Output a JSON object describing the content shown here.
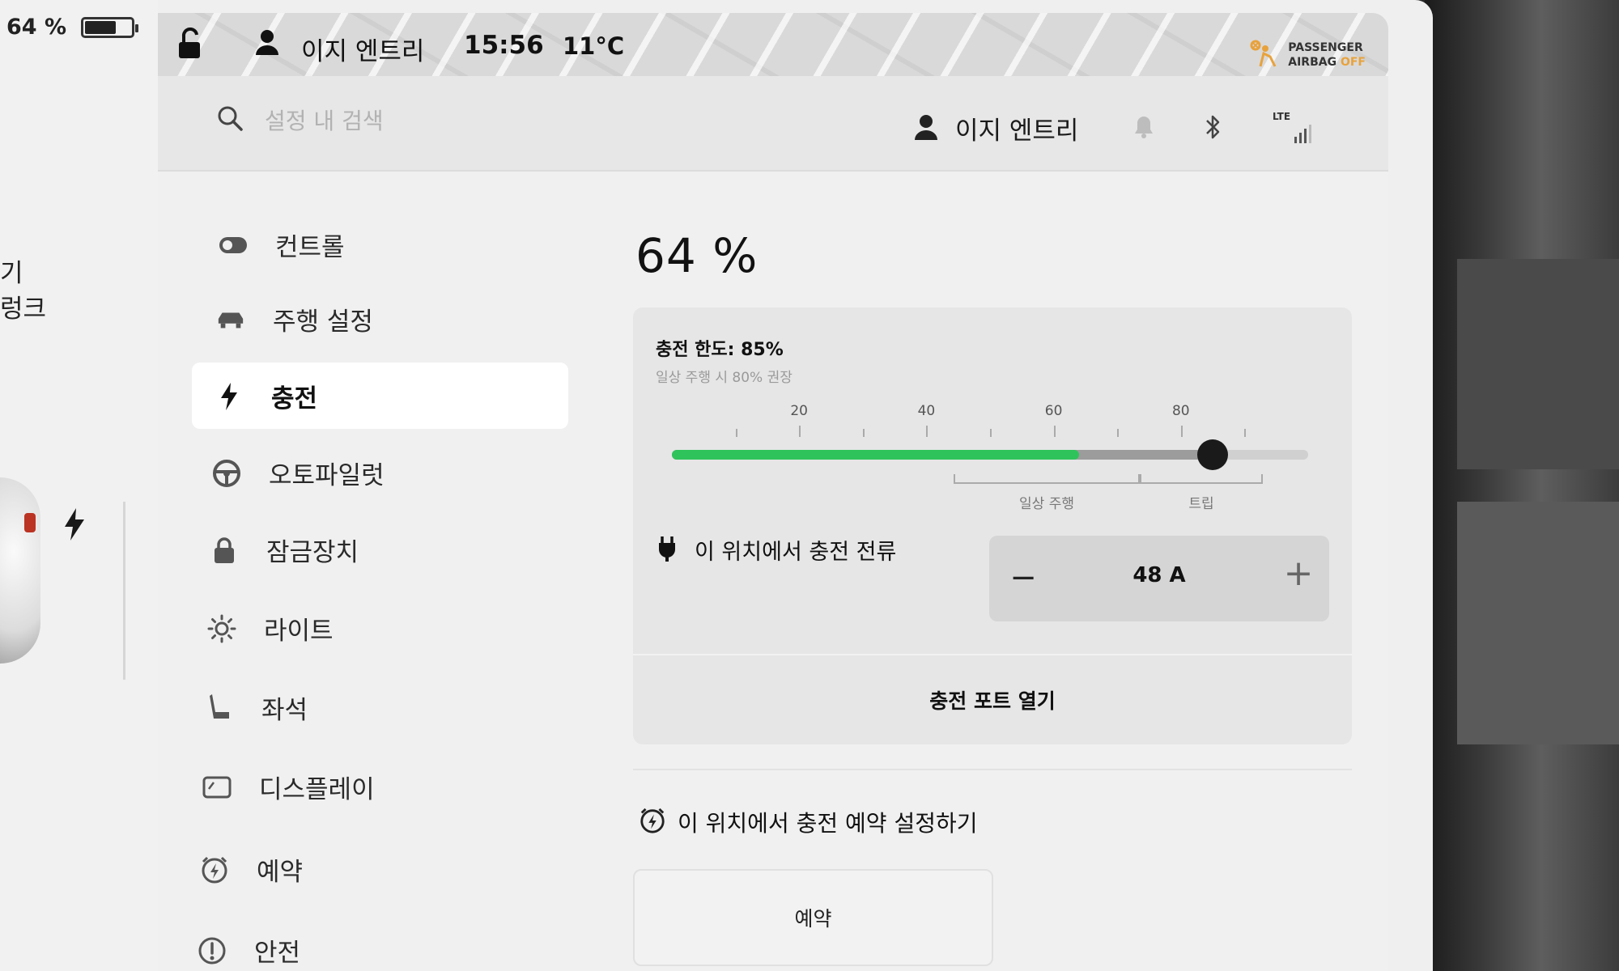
{
  "left_panel": {
    "battery_percent": "64 %",
    "battery_level": 0.64,
    "label_line1": "기",
    "label_line2": "렁크"
  },
  "status_bar": {
    "driver_name": "이지 엔트리",
    "time": "15:56",
    "temperature": "11°C",
    "airbag_line1": "PASSENGER",
    "airbag_line2_prefix": "AIRBAG ",
    "airbag_line2_state": "OFF"
  },
  "header": {
    "search_placeholder": "설정 내 검색",
    "profile_name": "이지 엔트리",
    "network_label": "LTE"
  },
  "sidebar": {
    "items": [
      {
        "label": "컨트롤",
        "icon": "toggle-icon"
      },
      {
        "label": "주행 설정",
        "icon": "car-icon"
      },
      {
        "label": "충전",
        "icon": "bolt-icon"
      },
      {
        "label": "오토파일럿",
        "icon": "steering-wheel-icon"
      },
      {
        "label": "잠금장치",
        "icon": "lock-icon"
      },
      {
        "label": "라이트",
        "icon": "sun-icon"
      },
      {
        "label": "좌석",
        "icon": "seat-icon"
      },
      {
        "label": "디스플레이",
        "icon": "display-icon"
      },
      {
        "label": "예약",
        "icon": "alarm-bolt-icon"
      },
      {
        "label": "안전",
        "icon": "alert-circle-icon"
      }
    ],
    "active_index": 2
  },
  "charging": {
    "battery_percent": "64 %",
    "limit_title": "충전 한도: 85%",
    "limit_hint": "일상 주행 시 80% 권장",
    "battery_level_value": 64,
    "charge_limit_value": 85,
    "tick_labels": [
      "20",
      "40",
      "60",
      "80"
    ],
    "range_daily": "일상 주행",
    "range_trip": "트립",
    "current_label": "이 위치에서 충전 전류",
    "current_value": "48 A",
    "minus_label": "−",
    "plus_label": "+",
    "open_port_label": "충전 포트 열기",
    "schedule_title": "이 위치에서 충전 예약 설정하기",
    "schedule_button": "예약",
    "accent_color": "#2fc45b"
  }
}
